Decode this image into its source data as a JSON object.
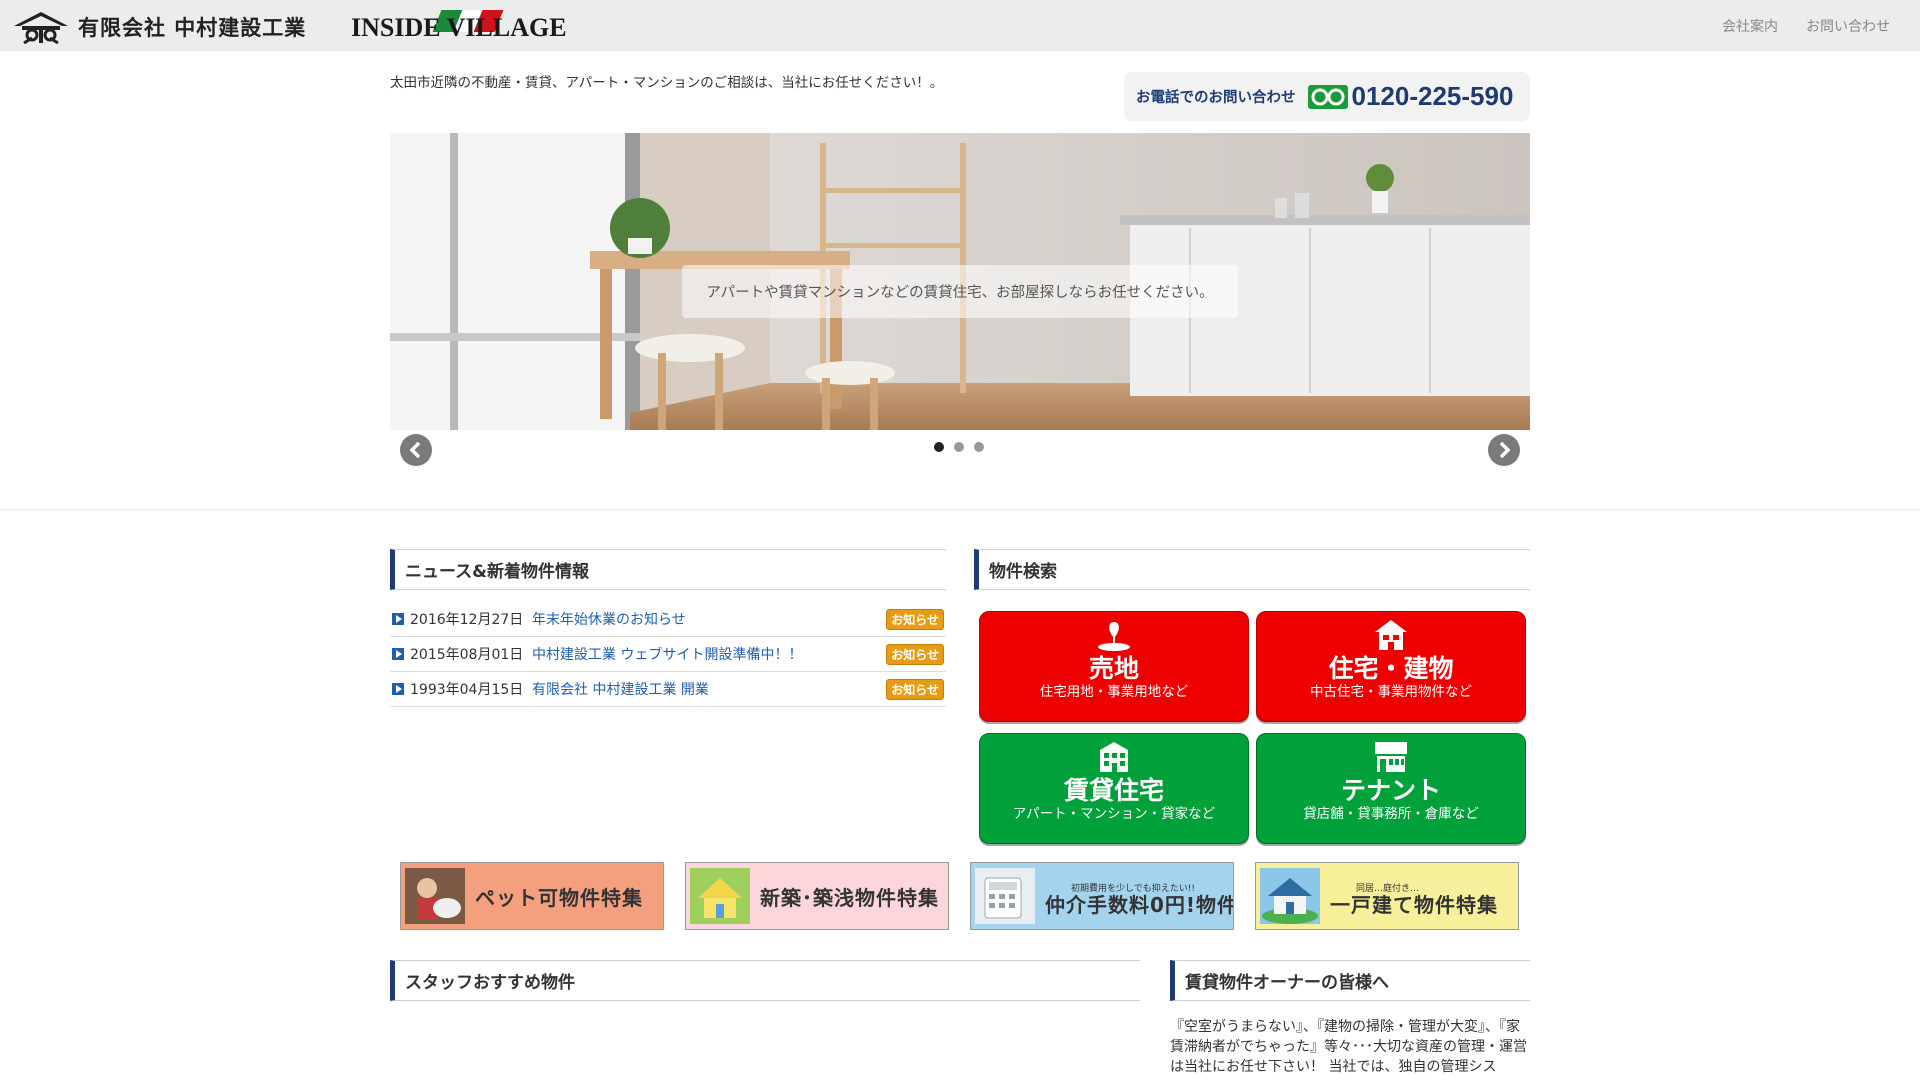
{
  "header": {
    "company_name": "有限会社 中村建設工業",
    "brand_name": "INSIDE VILLAGE",
    "nav": [
      {
        "label": "会社案内"
      },
      {
        "label": "お問い合わせ"
      }
    ],
    "tagline": "太田市近隣の不動産・賃貸、アパート・マンションのご相談は、当社にお任せください！。",
    "phone_label": "お電話でのお問い合わせ",
    "phone_number": "0120-225-590"
  },
  "slider": {
    "caption": "アパートや賃貸マンションなどの賃貸住宅、お部屋探しならお任せください。",
    "dots": [
      true,
      false,
      false
    ]
  },
  "news": {
    "heading": "ニュース&新着物件情報",
    "items": [
      {
        "date": "2016年12月27日",
        "title": "年末年始休業のお知らせ",
        "badge": "お知らせ"
      },
      {
        "date": "2015年08月01日",
        "title": "中村建設工業 ウェブサイト開設準備中！！",
        "badge": "お知らせ"
      },
      {
        "date": "1993年04月15日",
        "title": "有限会社 中村建設工業 開業",
        "badge": "お知らせ"
      }
    ]
  },
  "search": {
    "heading": "物件検索",
    "buttons": [
      {
        "title": "売地",
        "sub": "住宅用地・事業用地など",
        "color": "#ee0000"
      },
      {
        "title": "住宅・建物",
        "sub": "中古住宅・事業用物件など",
        "color": "#ee0000"
      },
      {
        "title": "賃貸住宅",
        "sub": "アパート・マンション・貸家など",
        "color": "#00a13a"
      },
      {
        "title": "テナント",
        "sub": "貸店舗・貸事務所・倉庫など",
        "color": "#00a13a"
      }
    ]
  },
  "banners": [
    {
      "label": "ペット可物件特集"
    },
    {
      "label": "新築･築浅物件特集"
    },
    {
      "label": "仲介手数料0円!物件",
      "small": "初期費用を少しでも抑えたい!!"
    },
    {
      "label": "一戸建て物件特集",
      "small": "同居…庭付き…"
    }
  ],
  "staff": {
    "heading": "スタッフおすすめ物件"
  },
  "owner": {
    "heading": "賃貸物件オーナーの皆様へ",
    "text": "『空室がうまらない』、『建物の掃除・管理が大変』、『家賃滞納者がでちゃった』等々･･･大切な資産の管理・運営は当社にお任せ下さい！ 当社では、独自の管理シス"
  },
  "colors": {
    "accent": "#1e3c73",
    "link": "#1f5fae",
    "red": "#ee0000",
    "green": "#00a13a",
    "badge": "#e89b14"
  }
}
